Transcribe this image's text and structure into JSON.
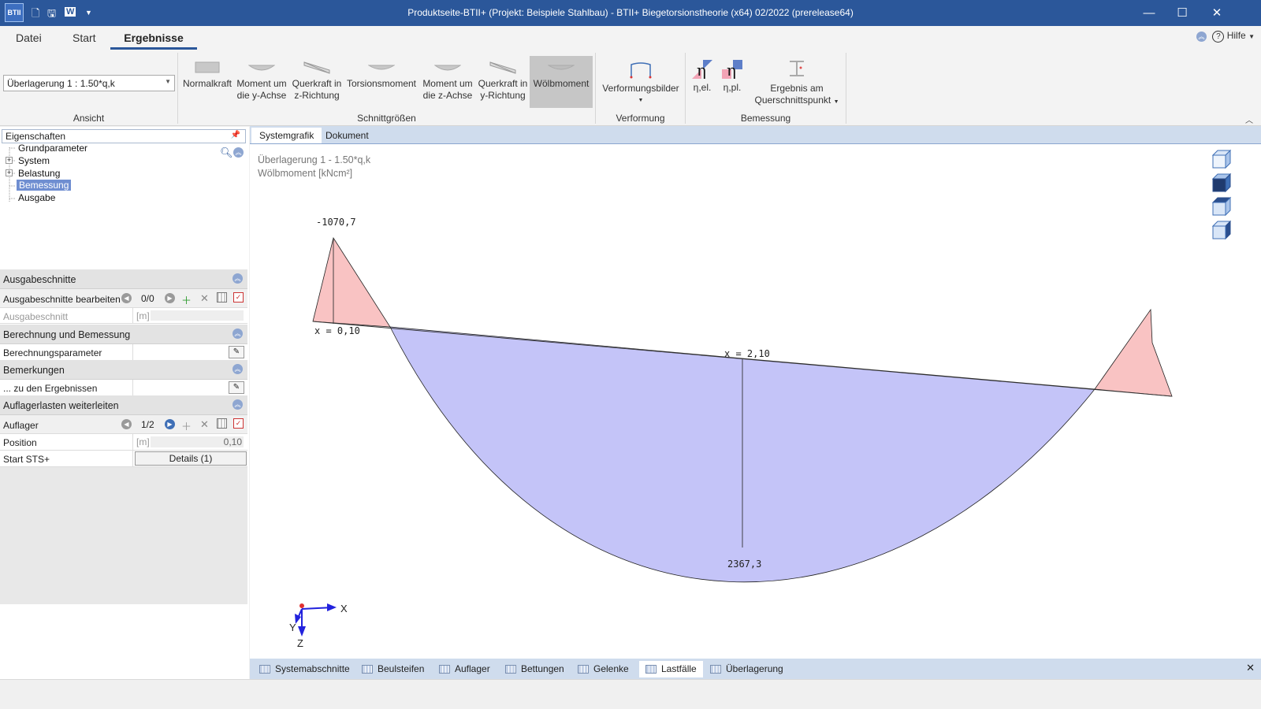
{
  "window": {
    "title": "Produktseite-BTII+ (Projekt: Beispiele Stahlbau) - BTII+ Biegetorsionstheorie (x64) 02/2022 (prerelease64)",
    "app_icon_text": "BTII",
    "minimize_label": "—",
    "maximize_label": "☐",
    "close_label": "✕"
  },
  "menu": {
    "tabs": [
      "Datei",
      "Start",
      "Ergebnisse"
    ],
    "active": "Ergebnisse",
    "help_label": "Hilfe"
  },
  "ribbon": {
    "ansicht": {
      "value": "Überlagerung 1 : 1.50*q,k",
      "group_label": "Ansicht"
    },
    "schnittgroessen": {
      "group_label": "Schnittgrößen",
      "buttons": [
        {
          "line1": "Normalkraft",
          "line2": ""
        },
        {
          "line1": "Moment um",
          "line2": "die y-Achse"
        },
        {
          "line1": "Querkraft in",
          "line2": "z-Richtung"
        },
        {
          "line1": "Torsionsmoment",
          "line2": ""
        },
        {
          "line1": "Moment um",
          "line2": "die z-Achse"
        },
        {
          "line1": "Querkraft in",
          "line2": "y-Richtung"
        },
        {
          "line1": "Wölbmoment",
          "line2": ""
        }
      ],
      "selected": "Wölbmoment"
    },
    "verformung": {
      "group_label": "Verformung",
      "button": "Verformungsbilder"
    },
    "bemessung": {
      "group_label": "Bemessung",
      "eta_el": "η,el.",
      "eta_pl": "η,pl.",
      "ergebnis_line1": "Ergebnis am",
      "ergebnis_line2": "Querschnittspunkt"
    }
  },
  "left": {
    "props_title": "Eigenschaften",
    "tree": [
      {
        "label": "Grundparameter",
        "expander": ""
      },
      {
        "label": "System",
        "expander": "+"
      },
      {
        "label": "Belastung",
        "expander": "+"
      },
      {
        "label": "Bemessung",
        "expander": ""
      },
      {
        "label": "Ausgabe",
        "expander": ""
      }
    ],
    "tree_selected": "Bemessung",
    "ausgabeschnitte": {
      "head": "Ausgabeschnitte",
      "edit_label": "Ausgabeschnitte bearbeiten",
      "counter": "0/0",
      "row_label": "Ausgabeschnitt",
      "row_unit": "[m]"
    },
    "berechnung": {
      "head": "Berechnung und Bemessung",
      "row_label": "Berechnungsparameter"
    },
    "bemerkungen": {
      "head": "Bemerkungen",
      "row_label": "... zu den Ergebnissen"
    },
    "auflager": {
      "head": "Auflagerlasten weiterleiten",
      "label": "Auflager",
      "counter": "1/2",
      "position_label": "Position",
      "position_unit": "[m]",
      "position_value": "0,10",
      "start_label": "Start STS+",
      "details_button": "Details (1)"
    }
  },
  "canvas": {
    "tabs": [
      "Systemgrafik",
      "Dokument"
    ],
    "active_tab": "Systemgrafik",
    "caption_line1": "Überlagerung 1 - 1.50*q,k",
    "caption_line2": "Wölbmoment [kNcm²]",
    "labels": {
      "max_neg": "-1070,7",
      "x_left": "x = 0,10",
      "x_mid": "x = 2,10",
      "max_pos": "2367,3"
    },
    "axes": {
      "x": "X",
      "y": "Y",
      "z": "Z"
    },
    "colors": {
      "negative_fill": "#f9c3c3",
      "positive_fill": "#c4c4f8",
      "outline": "#222222"
    }
  },
  "bottom_tabs": [
    "Systemabschnitte",
    "Beulsteifen",
    "Auflager",
    "Bettungen",
    "Gelenke",
    "Lastfälle",
    "Überlagerung"
  ],
  "bottom_active": "Lastfälle",
  "bottom_close": "✕"
}
